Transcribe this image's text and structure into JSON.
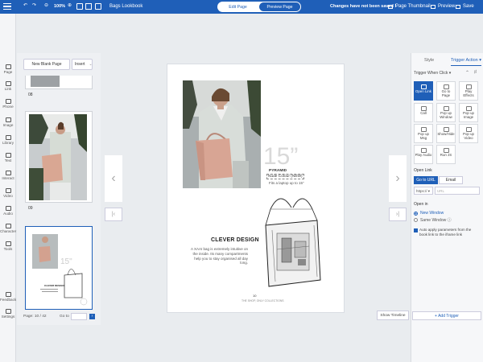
{
  "toolbar": {
    "zoom": "100%",
    "book_title": "Bags Lookbook",
    "mode_edit": "Edit Page",
    "mode_preview": "Preview Page",
    "status": "Changes have not been saved !",
    "page_thumbnail": "Page Thumbnail",
    "preview": "Preview",
    "save": "Save"
  },
  "left_nav": [
    {
      "label": "Page",
      "icon": "page-icon"
    },
    {
      "label": "Link",
      "icon": "link-icon"
    },
    {
      "label": "Phone",
      "icon": "phone-icon"
    },
    {
      "label": "Image",
      "icon": "image-icon"
    },
    {
      "label": "Library",
      "icon": "library-icon"
    },
    {
      "label": "Text",
      "icon": "text-icon"
    },
    {
      "label": "Interact",
      "icon": "interact-icon"
    },
    {
      "label": "Video",
      "icon": "video-icon"
    },
    {
      "label": "Audio",
      "icon": "audio-icon"
    },
    {
      "label": "Character",
      "icon": "character-icon"
    },
    {
      "label": "Tools",
      "icon": "tools-icon"
    },
    {
      "label": "Feedback",
      "icon": "feedback-icon"
    },
    {
      "label": "Settings",
      "icon": "settings-icon"
    }
  ],
  "thumbs": {
    "new_blank": "New Blank Page",
    "insert": "Insert",
    "label1": "08",
    "label2": "09",
    "page_indicator": "Page: 10 / 42",
    "goto": "Go to"
  },
  "page": {
    "number_text": "15”",
    "product_name": "PYRAMID",
    "colour": "Nude Colour (NEW)",
    "fits": "Fits a laptop up to 15”",
    "heading": "CLEVER DESIGN",
    "description": "A XAAI bag is extremely intuitive on the inside. Its many compartments help you to stay organised all day long.",
    "page_number": "10",
    "footer": "THE SHOP, ONLY COLLECTIONS"
  },
  "right_panel": {
    "tab_style": "Style",
    "tab_trigger": "Trigger Action",
    "trigger_when": "Trigger When Click",
    "actions": [
      {
        "label": "Open Link",
        "icon": "link-icon",
        "selected": true
      },
      {
        "label": "Go to Page",
        "icon": "goto-page-icon",
        "selected": false
      },
      {
        "label": "Play Effects",
        "icon": "effects-icon",
        "selected": false
      },
      {
        "label": "Call",
        "icon": "phone-icon",
        "selected": false
      },
      {
        "label": "Pop up Window",
        "icon": "window-icon",
        "selected": false
      },
      {
        "label": "Pop up Image",
        "icon": "image-icon",
        "selected": false
      },
      {
        "label": "Pop up Msg",
        "icon": "message-icon",
        "selected": false
      },
      {
        "label": "Show/Hide",
        "icon": "eye-icon",
        "selected": false
      },
      {
        "label": "Pop up Video",
        "icon": "video-icon",
        "selected": false
      },
      {
        "label": "Play Audio",
        "icon": "audio-icon",
        "selected": false
      },
      {
        "label": "Run JS",
        "icon": "js-icon",
        "selected": false
      }
    ],
    "open_link_label": "Open Link",
    "goto_url": "Go to URL",
    "email": "Email",
    "protocol": "https://",
    "url_placeholder": "URL",
    "open_in_label": "Open in",
    "new_window": "New Window",
    "same_window": "Same Window",
    "auto_apply": "Auto apply parameters from the book link to the iframe link",
    "add_trigger": "+ Add Trigger",
    "show_timeline": "Show Timeline"
  },
  "colors": {
    "brand": "#1f5fb8"
  }
}
